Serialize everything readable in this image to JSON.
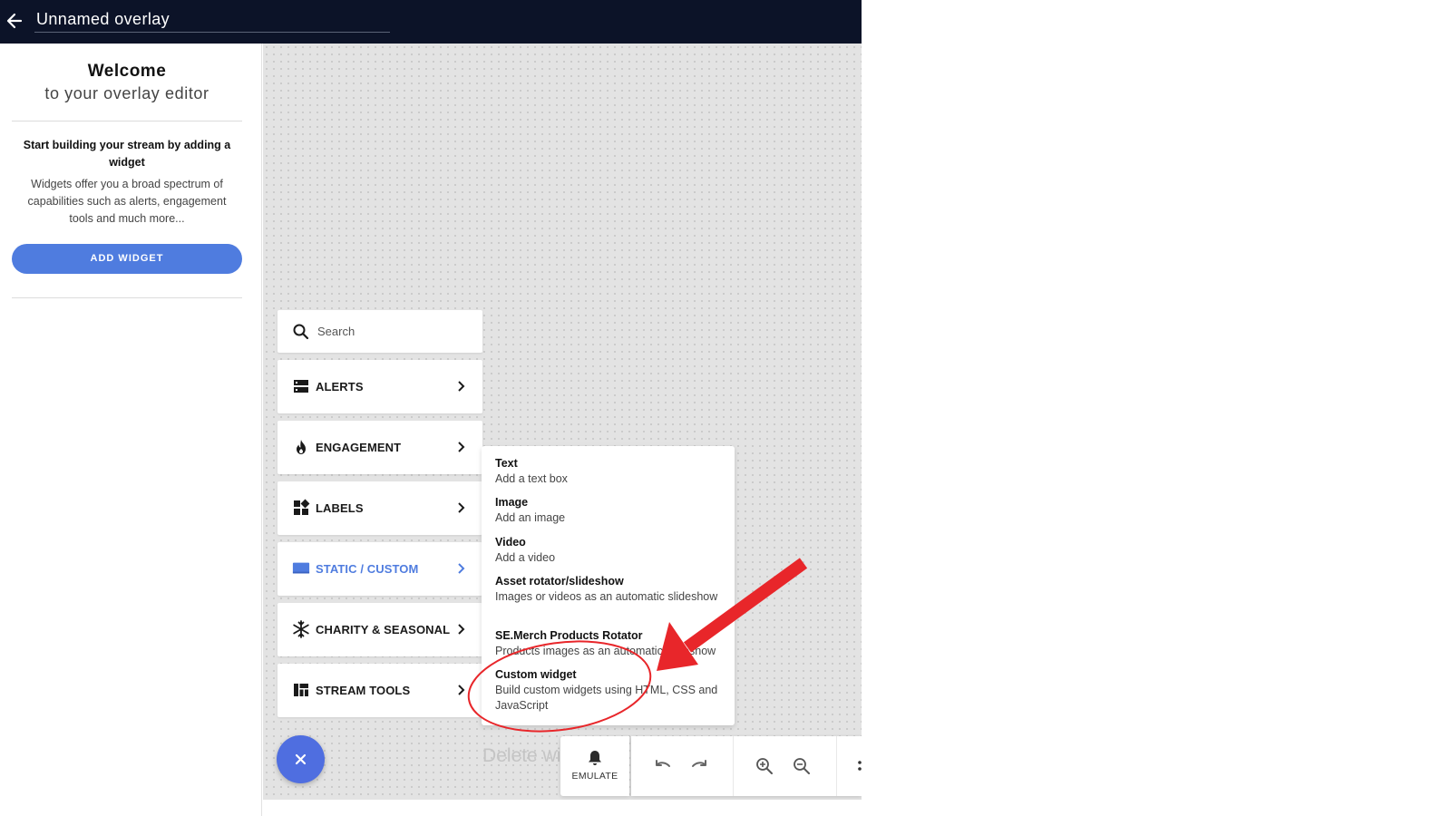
{
  "header": {
    "title": "Unnamed overlay",
    "back_icon": "arrow-left-icon"
  },
  "sidebar": {
    "welcome_title": "Welcome",
    "welcome_subtitle": "to your overlay editor",
    "start_heading": "Start building your stream by adding a widget",
    "start_description": "Widgets offer you a broad spectrum of capabilities such as alerts, engagement tools and much more...",
    "add_widget_label": "ADD WIDGET"
  },
  "widget_menu": {
    "search_placeholder": "Search",
    "categories": [
      {
        "label": "ALERTS",
        "icon": "alerts-icon"
      },
      {
        "label": "ENGAGEMENT",
        "icon": "flame-icon"
      },
      {
        "label": "LABELS",
        "icon": "labels-icon"
      },
      {
        "label": "STATIC / CUSTOM",
        "icon": "monitor-icon",
        "active": true
      },
      {
        "label": "CHARITY & SEASONAL",
        "icon": "snowflake-icon"
      },
      {
        "label": "STREAM TOOLS",
        "icon": "dashboard-icon"
      }
    ],
    "submenu": [
      {
        "title": "Text",
        "description": "Add a text box"
      },
      {
        "title": "Image",
        "description": "Add an image"
      },
      {
        "title": "Video",
        "description": "Add a video"
      },
      {
        "title": "Asset rotator/slideshow",
        "description": "Images or videos as an automatic slideshow"
      },
      {
        "title": "SE.Merch Products Rotator",
        "description": "Products images as an automatic slideshow"
      },
      {
        "title": "Custom widget",
        "description": "Build custom widgets using HTML, CSS and JavaScript"
      }
    ]
  },
  "canvas": {
    "ghost_text": "Delete widget"
  },
  "bottom_toolbar": {
    "emulate_label": "EMULATE",
    "buttons": [
      "undo-icon",
      "redo-icon",
      "zoom-in-icon",
      "zoom-out-icon",
      "more-icon"
    ]
  },
  "colors": {
    "topbar": "#0c1328",
    "accent": "#4f7cdf",
    "fab": "#4f6ee0",
    "annotation": "#e8262a",
    "canvas": "#e3e3e3"
  }
}
